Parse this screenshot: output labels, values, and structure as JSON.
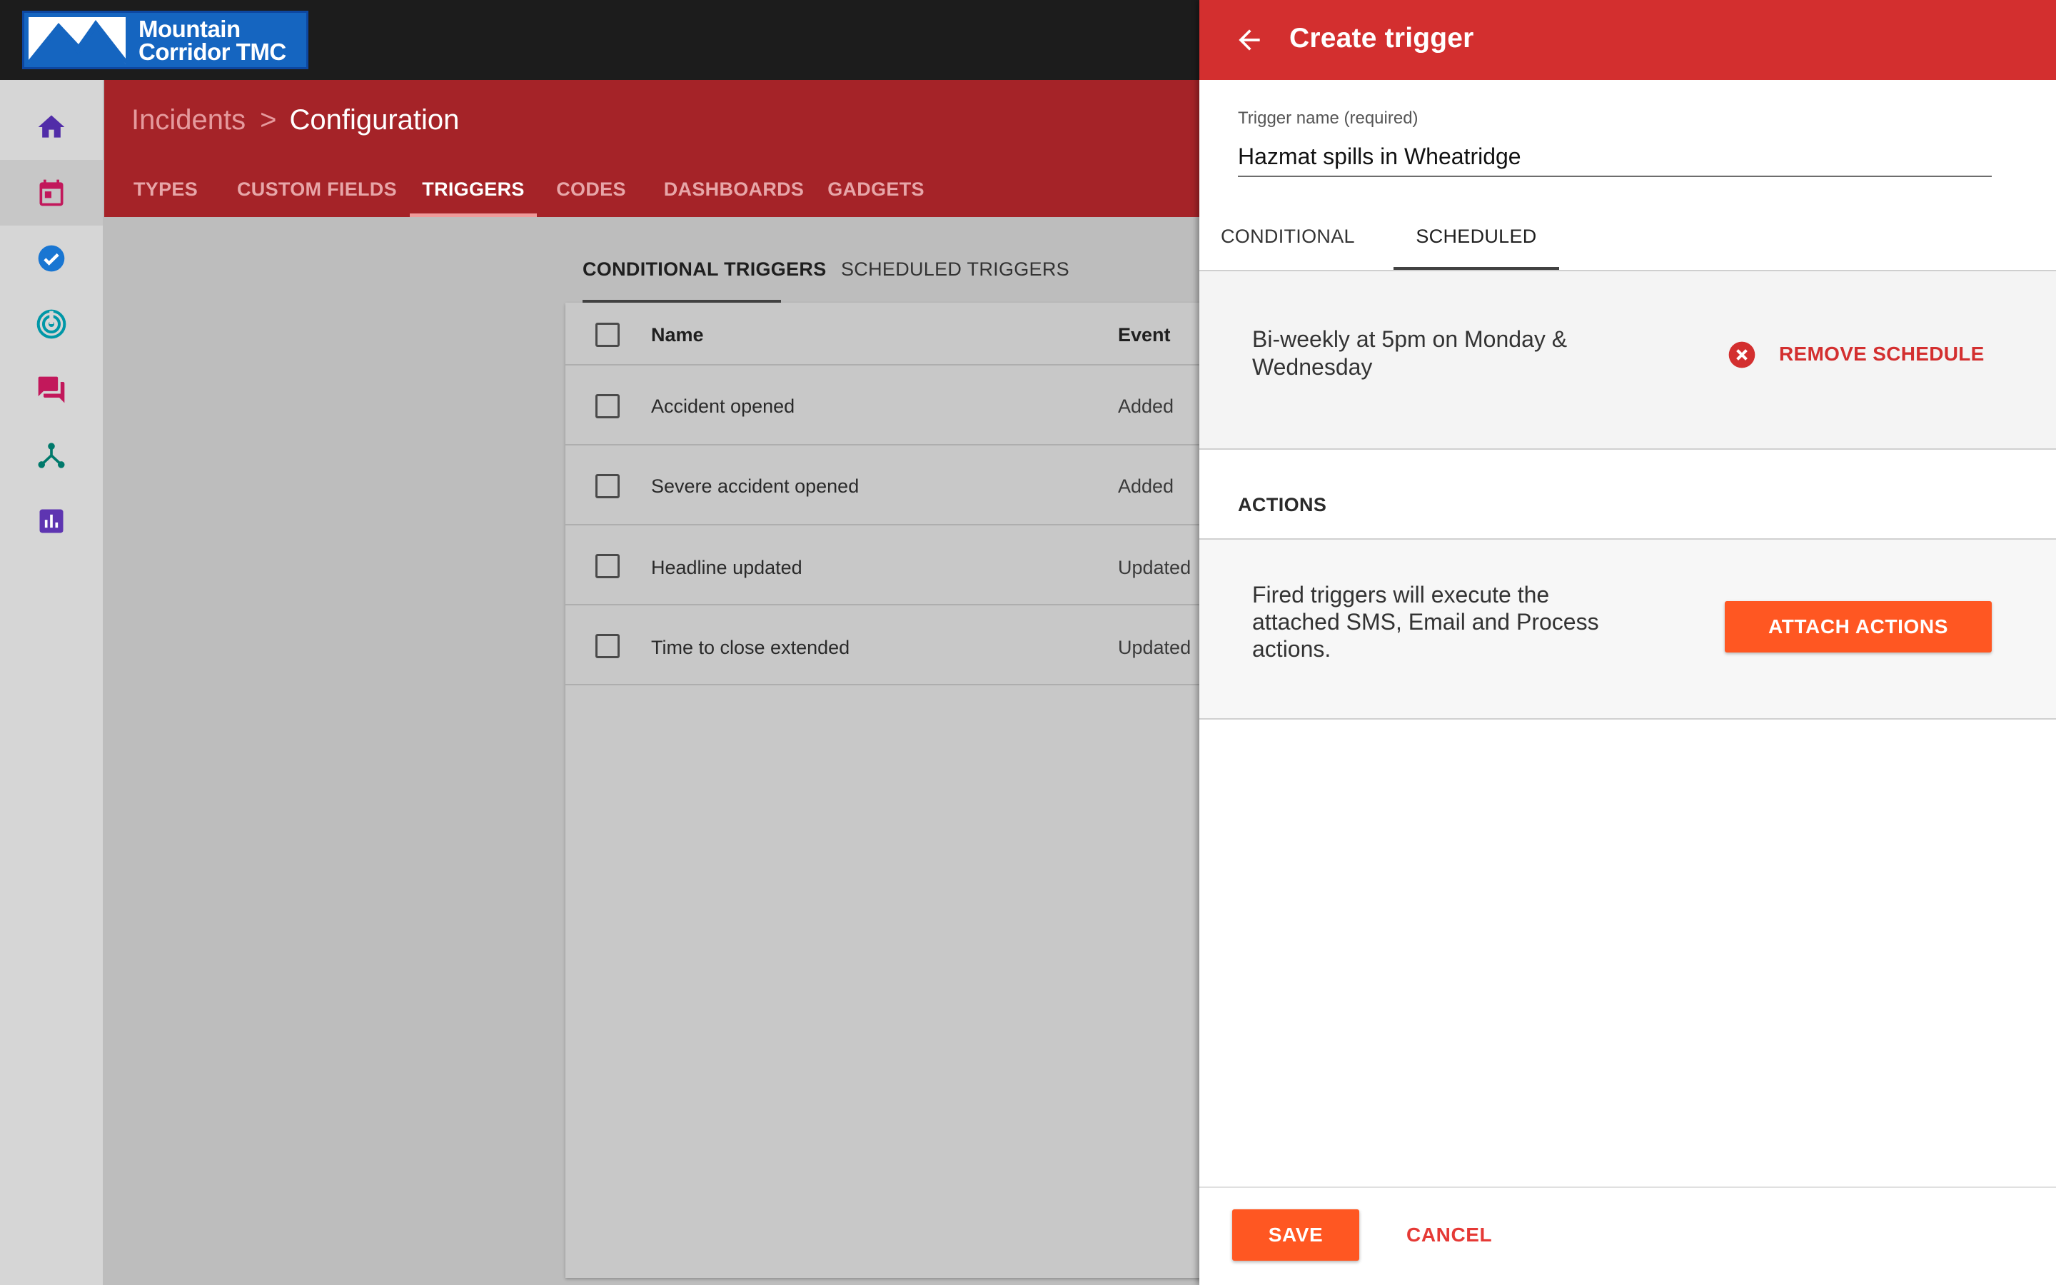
{
  "app": {
    "logo_line1": "Mountain",
    "logo_line2": "Corridor TMC"
  },
  "sidebar": {
    "items": [
      {
        "icon": "home-icon",
        "color": "#512da8",
        "active": false
      },
      {
        "icon": "calendar-icon",
        "color": "#c2185b",
        "active": true
      },
      {
        "icon": "check-circle-icon",
        "color": "#1976d2",
        "active": false
      },
      {
        "icon": "radar-icon",
        "color": "#0097a7",
        "active": false
      },
      {
        "icon": "chat-icon",
        "color": "#c2185b",
        "active": false
      },
      {
        "icon": "workflow-icon",
        "color": "#00796b",
        "active": false
      },
      {
        "icon": "chart-icon",
        "color": "#5e35b1",
        "active": false
      }
    ]
  },
  "header": {
    "breadcrumb_parent": "Incidents",
    "breadcrumb_separator": ">",
    "breadcrumb_current": "Configuration",
    "tabs": [
      {
        "label": "TYPES"
      },
      {
        "label": "CUSTOM FIELDS"
      },
      {
        "label": "TRIGGERS",
        "active": true
      },
      {
        "label": "CODES"
      },
      {
        "label": "DASHBOARDS"
      },
      {
        "label": "GADGETS"
      }
    ]
  },
  "content": {
    "subtabs": [
      {
        "label": "CONDITIONAL TRIGGERS",
        "active": true
      },
      {
        "label": "SCHEDULED TRIGGERS"
      }
    ],
    "table": {
      "columns": [
        "Name",
        "Event"
      ],
      "rows": [
        {
          "name": "Accident opened",
          "event": "Added"
        },
        {
          "name": "Severe accident opened",
          "event": "Added"
        },
        {
          "name": "Headline updated",
          "event": "Updated"
        },
        {
          "name": "Time to close extended",
          "event": "Updated"
        }
      ]
    }
  },
  "panel": {
    "title": "Create trigger",
    "field_label": "Trigger name (required)",
    "field_value": "Hazmat spills in Wheatridge",
    "tabs": [
      {
        "label": "CONDITIONAL"
      },
      {
        "label": "SCHEDULED",
        "active": true
      }
    ],
    "schedule_text": "Bi-weekly at 5pm on Monday & Wednesday",
    "remove_schedule_label": "REMOVE SCHEDULE",
    "actions_heading": "ACTIONS",
    "actions_text": "Fired triggers will execute the attached SMS, Email and Process actions.",
    "attach_actions_label": "ATTACH ACTIONS",
    "save_label": "SAVE",
    "cancel_label": "CANCEL"
  },
  "colors": {
    "header_red": "#a52328",
    "panel_red": "#d32f2f",
    "accent_orange": "#ff5722"
  }
}
